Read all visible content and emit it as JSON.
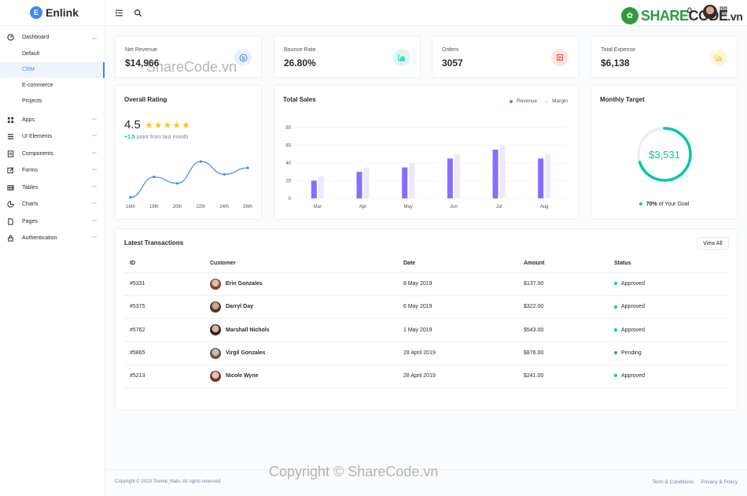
{
  "brand": {
    "name": "Enlink",
    "mark": "E"
  },
  "sidebar": {
    "dashboard": {
      "label": "Dashboard",
      "icon": "dashboard-icon"
    },
    "sub_items": [
      {
        "label": "Default"
      },
      {
        "label": "CRM"
      },
      {
        "label": "E-commerce"
      },
      {
        "label": "Projects"
      }
    ],
    "items": [
      {
        "label": "Apps",
        "icon": "apps-icon"
      },
      {
        "label": "UI Elements",
        "icon": "ui-elements-icon"
      },
      {
        "label": "Components",
        "icon": "components-icon"
      },
      {
        "label": "Forms",
        "icon": "forms-icon"
      },
      {
        "label": "Tables",
        "icon": "tables-icon"
      },
      {
        "label": "Charts",
        "icon": "charts-icon"
      },
      {
        "label": "Pages",
        "icon": "pages-icon"
      },
      {
        "label": "Authentication",
        "icon": "lock-icon"
      }
    ]
  },
  "watermark": {
    "logo_text_1": "SHARE",
    "logo_text_2": "CODE",
    "logo_text_3": ".vn",
    "overlay_1": "ShareCode.vn",
    "overlay_2": "Copyright © ShareCode.vn"
  },
  "stats": [
    {
      "label": "Net Revenue",
      "value": "$14,966",
      "icon": "$",
      "color": "#3f87f5",
      "bg": "#e6f0fe"
    },
    {
      "label": "Bounce Rate",
      "value": "26.80%",
      "icon": "bar-chart-icon",
      "color": "#00c9a7",
      "bg": "#dbf7f2"
    },
    {
      "label": "Orders",
      "value": "3057",
      "icon": "orders-icon",
      "color": "#de4436",
      "bg": "#fbe6e4"
    },
    {
      "label": "Total Expense",
      "value": "$6,138",
      "icon": "bar-chart-icon",
      "color": "#fcc32d",
      "bg": "#fff6dc"
    }
  ],
  "rating": {
    "title": "Overall Rating",
    "value": "4.5",
    "stars": "★★★★★",
    "delta": "+1.5",
    "delta_text": " point from last month",
    "chart_data": {
      "type": "line",
      "categories": [
        "16th",
        "19th",
        "20th",
        "22th",
        "24th",
        "26th"
      ],
      "values": [
        2,
        18,
        13,
        30,
        20,
        25
      ],
      "ylim": [
        0,
        35
      ],
      "color": "#3f87f5"
    }
  },
  "sales": {
    "title": "Total Sales",
    "legend": [
      {
        "name": "Revenue",
        "color": "#886cff"
      },
      {
        "name": "Margin",
        "color": "#ece9ff"
      }
    ],
    "chart_data": {
      "type": "bar",
      "title": "Total Sales",
      "categories": [
        "Mar",
        "Apr",
        "May",
        "Jun",
        "Jul",
        "Aug"
      ],
      "series": [
        {
          "name": "Revenue",
          "values": [
            20,
            30,
            35,
            45,
            55,
            45
          ]
        },
        {
          "name": "Margin",
          "values": [
            25,
            35,
            40,
            50,
            60,
            50
          ]
        }
      ],
      "yticks": [
        0,
        20,
        40,
        60,
        80
      ],
      "ylim": [
        0,
        80
      ]
    }
  },
  "target": {
    "title": "Monthly Target",
    "value": "$3,531",
    "percent": 70,
    "pct_text": "70%",
    "goal_text": " of Your Goal",
    "color": "#00c9a7"
  },
  "transactions": {
    "title": "Latest Transactions",
    "view_all": "View All",
    "headers": [
      "ID",
      "Customer",
      "Date",
      "Amount",
      "Status"
    ],
    "rows": [
      {
        "id": "#5331",
        "customer": "Erin Gonzales",
        "date": "8 May 2019",
        "amount": "$137.00",
        "status": "Approved",
        "status_color": "#00c9a7"
      },
      {
        "id": "#5375",
        "customer": "Darryl Day",
        "date": "6 May 2019",
        "amount": "$322.00",
        "status": "Approved",
        "status_color": "#00c9a7"
      },
      {
        "id": "#5762",
        "customer": "Marshall Nichols",
        "date": "1 May 2019",
        "amount": "$543.00",
        "status": "Approved",
        "status_color": "#00c9a7"
      },
      {
        "id": "#5865",
        "customer": "Virgil Gonzales",
        "date": "28 April 2019",
        "amount": "$876.00",
        "status": "Pending",
        "status_color": "#3f87f5"
      },
      {
        "id": "#5213",
        "customer": "Nicole Wyne",
        "date": "28 April 2019",
        "amount": "$241.00",
        "status": "Approved",
        "status_color": "#00c9a7"
      }
    ]
  },
  "footer": {
    "copyright": "Copyright © 2019 Theme_Nate. All rights reserved.",
    "links": [
      "Term & Conditions",
      "Privacy & Policy"
    ]
  }
}
